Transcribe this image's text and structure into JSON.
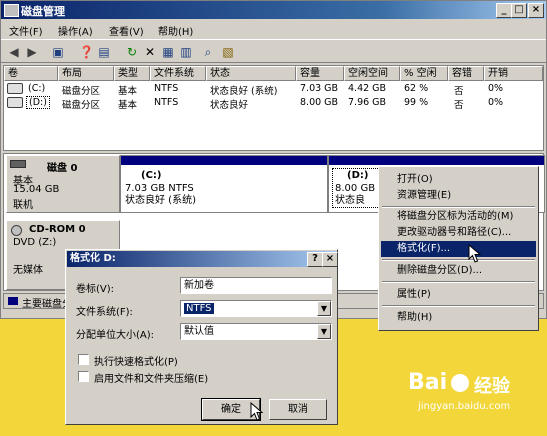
{
  "window": {
    "title": "磁盘管理",
    "menu": [
      "文件(F)",
      "操作(A)",
      "查看(V)",
      "帮助(H)"
    ],
    "controls": [
      "_",
      "□",
      "×"
    ]
  },
  "volumes": {
    "headers": [
      "卷",
      "布局",
      "类型",
      "文件系统",
      "状态",
      "容量",
      "空闲空间",
      "% 空闲",
      "容错",
      "开销"
    ],
    "rows": [
      [
        "(C:)",
        "磁盘分区",
        "基本",
        "NTFS",
        "状态良好 (系统)",
        "7.03 GB",
        "4.42 GB",
        "62 %",
        "否",
        "0%"
      ],
      [
        "(D:)",
        "磁盘分区",
        "基本",
        "NTFS",
        "状态良好",
        "8.00 GB",
        "7.96 GB",
        "99 %",
        "否",
        "0%"
      ]
    ]
  },
  "disks": {
    "disk0": {
      "name": "磁盘 0",
      "type": "基本",
      "size": "15.04 GB",
      "status": "联机"
    },
    "part_c": {
      "label": "(C:)",
      "size": "7.03 GB NTFS",
      "status": "状态良好 (系统)"
    },
    "part_d": {
      "label": "(D:)",
      "size": "8.00 GB",
      "status": "状态良"
    },
    "cdrom": {
      "name": "CD-ROM 0",
      "drive": "DVD (Z:)",
      "media": "无媒体"
    }
  },
  "legend": {
    "primary": "主要磁盘分"
  },
  "context_menu": {
    "items": [
      "打开(O)",
      "资源管理(E)",
      "将磁盘分区标为活动的(M)",
      "更改驱动器号和路径(C)...",
      "格式化(F)...",
      "删除磁盘分区(D)...",
      "属性(P)",
      "帮助(H)"
    ],
    "highlighted": "格式化(F)..."
  },
  "format_dialog": {
    "title": "格式化 D:",
    "help": "?",
    "close": "×",
    "volume_label": {
      "label": "卷标(V):",
      "value": "新加卷"
    },
    "file_system": {
      "label": "文件系统(F):",
      "value": "NTFS"
    },
    "alloc_unit": {
      "label": "分配单位大小(A):",
      "value": "默认值"
    },
    "quick_format": "执行快速格式化(P)",
    "compression": "启用文件和文件夹压缩(E)",
    "ok": "确定",
    "cancel": "取消"
  },
  "watermark": {
    "brand": "Bai",
    "brand2": "经验",
    "url": "jingyan.baidu.com"
  },
  "colors": {
    "accent": "#0a246a",
    "selection": "#0a246a",
    "bar": "#00007f",
    "background": "#f2d63a"
  }
}
